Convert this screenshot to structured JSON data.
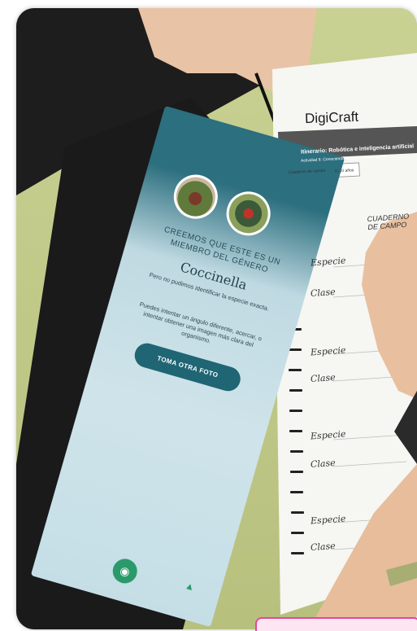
{
  "tablet": {
    "result_heading": "CREEMOS QUE ESTE ES UN MIEMBRO DEL GÉNERO",
    "genus": "Coccinella",
    "species_message": "Pero no pudimos identificar la especie exacta.",
    "tip": "Puedes intentar un ángulo diferente, acercar, o intentar obtener una imagen más clara del organismo.",
    "retake_button": "TOMA OTRA FOTO",
    "camera_icon": "camera-icon",
    "bell_icon": "bell-icon"
  },
  "worksheet": {
    "brand": "DigiCraft",
    "itinerary": "Itinerario: Robótica e inteligencia artificial",
    "activity": "Actividad 8: Conociendo nuestro entorno con IA",
    "tab_left": "Cuaderno de campo",
    "tab_right": "8–10 años",
    "notebook_header": "CUADERNO DE CAMPO",
    "labels": [
      "Especie",
      "Clase",
      "Especie",
      "Clase",
      "Especie",
      "Clase",
      "Especie",
      "Clase"
    ]
  },
  "colors": {
    "tablet_teal": "#2c6f7e",
    "button_teal": "#1f6574",
    "tablet_screen_light": "#cfe4ea",
    "accent_pink": "#e2489a"
  }
}
